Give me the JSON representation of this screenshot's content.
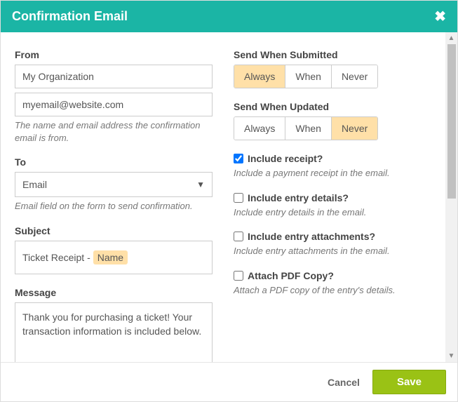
{
  "header": {
    "title": "Confirmation Email"
  },
  "left": {
    "from": {
      "label": "From",
      "org": "My Organization",
      "email": "myemail@website.com",
      "helper": "The name and email address the confirmation email is from."
    },
    "to": {
      "label": "To",
      "value": "Email",
      "helper": "Email field on the form to send confirmation."
    },
    "subject": {
      "label": "Subject",
      "prefix": "Ticket Receipt - ",
      "chip": "Name"
    },
    "message": {
      "label": "Message",
      "body": "Thank you for purchasing a ticket! Your transaction information is included below."
    }
  },
  "right": {
    "send_submitted": {
      "label": "Send When Submitted",
      "options": [
        "Always",
        "When",
        "Never"
      ],
      "active": 0
    },
    "send_updated": {
      "label": "Send When Updated",
      "options": [
        "Always",
        "When",
        "Never"
      ],
      "active": 2
    },
    "include_receipt": {
      "label": "Include receipt?",
      "checked": true,
      "helper": "Include a payment receipt in the email."
    },
    "include_entry_details": {
      "label": "Include entry details?",
      "checked": false,
      "helper": "Include entry details in the email."
    },
    "include_attachments": {
      "label": "Include entry attachments?",
      "checked": false,
      "helper": "Include entry attachments in the email."
    },
    "attach_pdf": {
      "label": "Attach PDF Copy?",
      "checked": false,
      "helper": "Attach a PDF copy of the entry's details."
    }
  },
  "footer": {
    "cancel": "Cancel",
    "save": "Save"
  }
}
